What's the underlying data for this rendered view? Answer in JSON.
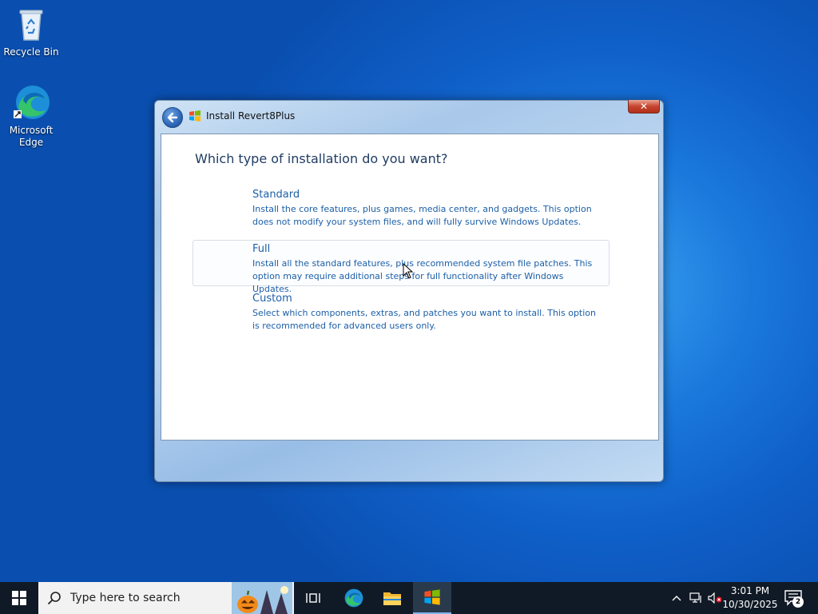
{
  "desktop": {
    "icons": [
      {
        "label": "Recycle Bin",
        "icon": "recycle-bin-icon"
      },
      {
        "label": "Microsoft Edge",
        "icon": "edge-icon"
      }
    ]
  },
  "window": {
    "title": "Install Revert8Plus",
    "close_label": "✕",
    "heading": "Which type of installation do you want?",
    "options": [
      {
        "title": "Standard",
        "description": "Install the core features, plus games, media center, and gadgets. This option does not modify your system files, and will fully survive Windows Updates."
      },
      {
        "title": "Full",
        "description": "Install all the standard features, plus recommended system file patches. This option may require additional steps for full functionality after Windows Updates."
      },
      {
        "title": "Custom",
        "description": "Select which components, extras, and patches you want to install. This option is recommended for advanced users only."
      }
    ]
  },
  "taskbar": {
    "search_placeholder": "Type here to search",
    "clock_time": "3:01 PM",
    "clock_date": "10/30/2025",
    "notification_count": "2"
  },
  "colors": {
    "option_text": "#1c5fa8",
    "heading_text": "#1f3c63",
    "taskbar_bg": "#101a26"
  }
}
